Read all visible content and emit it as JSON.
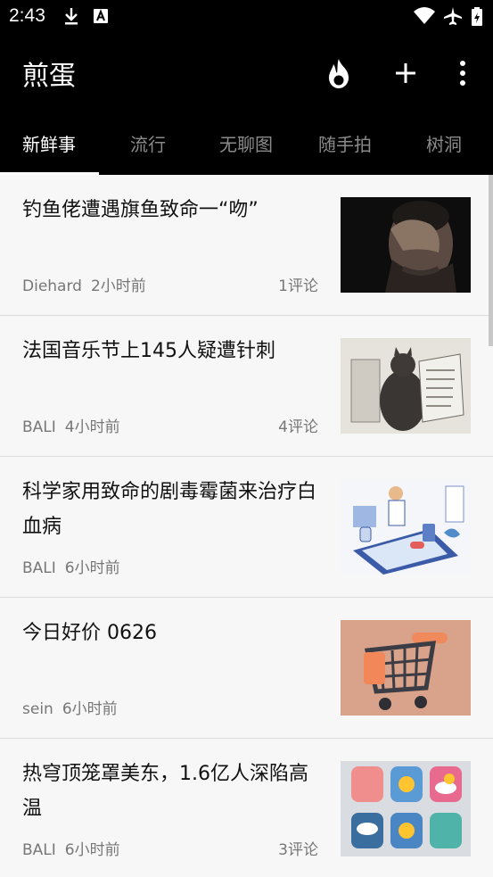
{
  "status_bar": {
    "time": "2:43"
  },
  "app_bar": {
    "title": "煎蛋"
  },
  "tabs": [
    {
      "label": "新鲜事"
    },
    {
      "label": "流行"
    },
    {
      "label": "无聊图"
    },
    {
      "label": "随手拍"
    },
    {
      "label": "树洞"
    }
  ],
  "posts": [
    {
      "title": "钓鱼佬遭遇旗鱼致命一“吻”",
      "author": "Diehard",
      "time": "2小时前",
      "comments": "1评论"
    },
    {
      "title": "法国音乐节上145人疑遭针刺",
      "author": "BALI",
      "time": "4小时前",
      "comments": "4评论"
    },
    {
      "title": "科学家用致命的剧毒霉菌来治疗白血病",
      "author": "BALI",
      "time": "6小时前",
      "comments": ""
    },
    {
      "title": "今日好价 0626",
      "author": "sein",
      "time": "6小时前",
      "comments": ""
    },
    {
      "title": "热穹顶笼罩美东，1.6亿人深陷高温",
      "author": "BALI",
      "time": "6小时前",
      "comments": "3评论"
    }
  ],
  "colors": {
    "background": "#000000",
    "list_bg": "#f7f7f7",
    "tab_inactive": "#8a8a8a",
    "meta": "#777777"
  }
}
